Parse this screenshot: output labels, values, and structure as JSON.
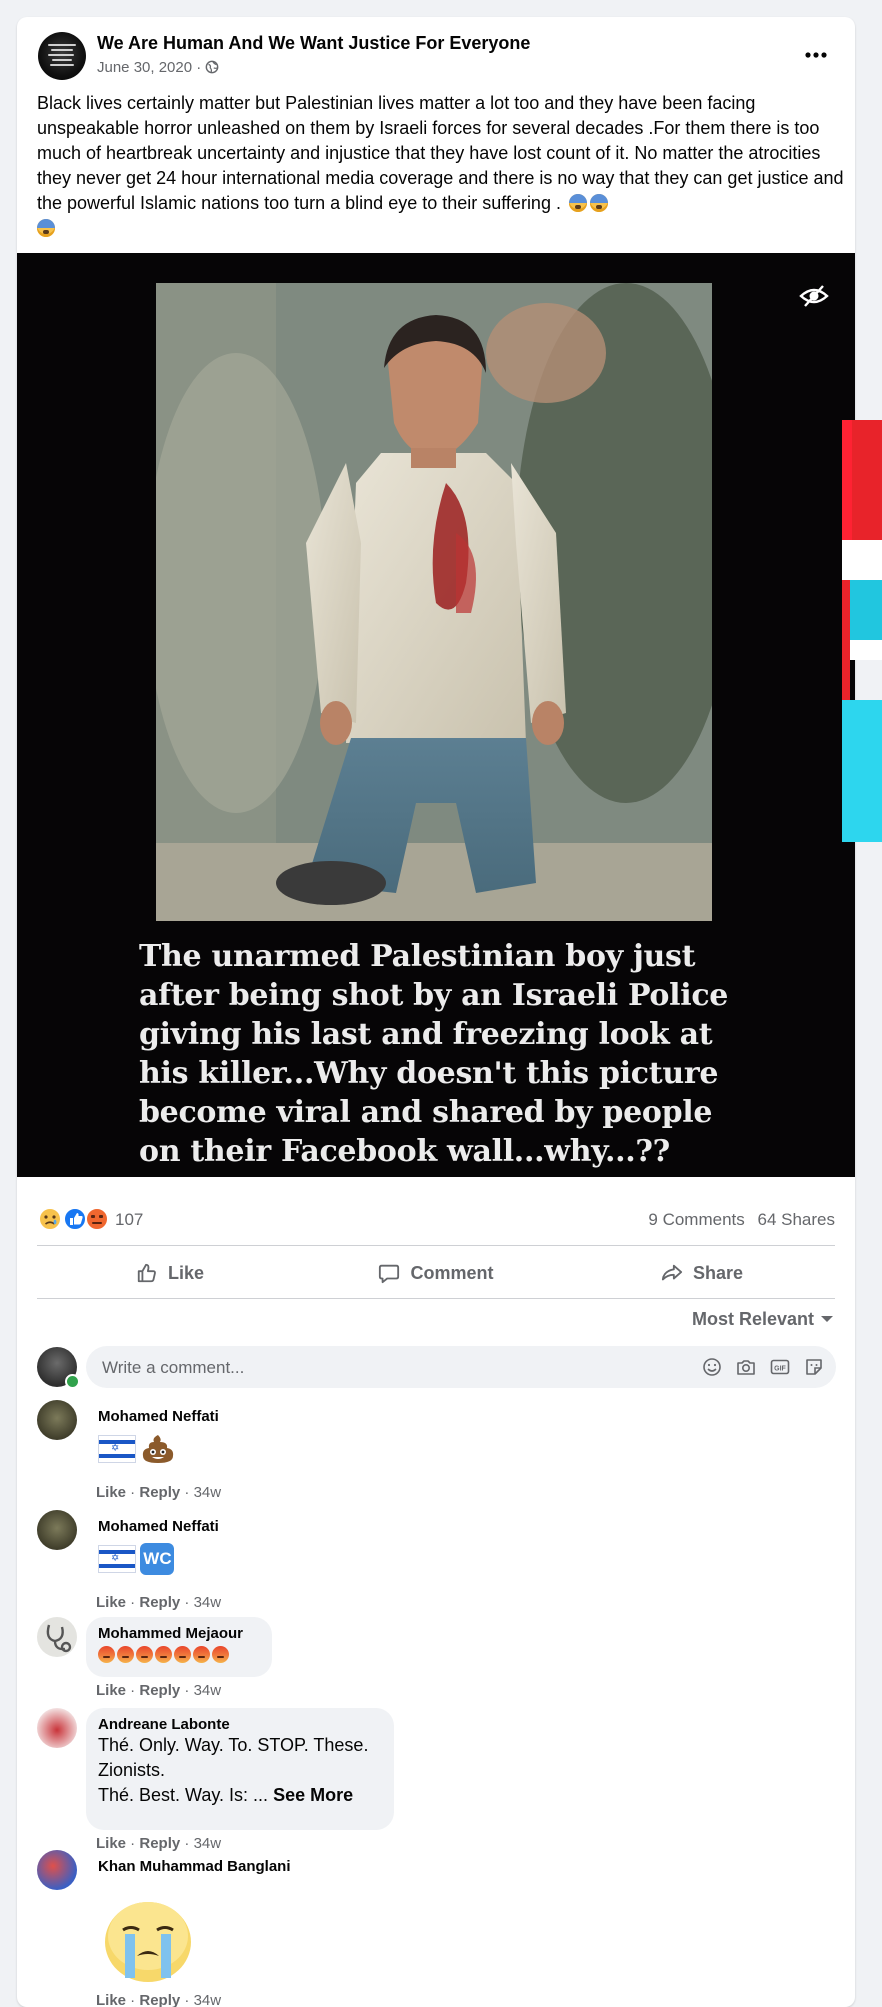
{
  "post": {
    "page_name": "We Are Human And We Want Justice For Everyone",
    "date": "June 30, 2020 ·",
    "text": "Black lives certainly matter but Palestinian lives matter a lot too and they have been facing unspeakable horror unleashed on them by Israeli forces for several decades .For them there is too much of heartbreak uncertainty and injustice that they have lost count of it. No matter the atrocities they never get 24 hour international media coverage and there is no way that they can get justice and the powerful Islamic nations too turn a blind eye to their suffering .",
    "text_emojis": [
      "fearful-face",
      "fearful-face",
      "fearful-face"
    ]
  },
  "image": {
    "caption": "The unarmed Palestinian boy just after being shot by an Israeli Police giving his last and freezing look at his killer...Why doesn't this picture become viral and shared by people on their Facebook wall...why...??"
  },
  "engagement": {
    "reaction_icons": [
      "sad",
      "like",
      "angry"
    ],
    "reaction_count": "107",
    "comments": "9 Comments",
    "shares": "64 Shares"
  },
  "actions": {
    "like": "Like",
    "comment": "Comment",
    "share": "Share"
  },
  "sort": {
    "label": "Most Relevant"
  },
  "comment_input": {
    "placeholder": "Write a comment..."
  },
  "comments": [
    {
      "name": "Mohamed Neffati",
      "emojis": [
        "israel-flag",
        "pile-of-poo"
      ],
      "like": "Like",
      "reply": "Reply",
      "time": "34w"
    },
    {
      "name": "Mohamed Neffati",
      "emojis": [
        "israel-flag",
        "wc-sign"
      ],
      "like": "Like",
      "reply": "Reply",
      "time": "34w",
      "wc_text": "WC"
    },
    {
      "name": "Mohammed Mejaour",
      "emojis": [
        "angry",
        "angry",
        "angry",
        "angry",
        "angry",
        "angry",
        "angry"
      ],
      "like": "Like",
      "reply": "Reply",
      "time": "34w"
    },
    {
      "name": "Andreane Labonte",
      "line1": "Thé. Only. Way. To. STOP. These.",
      "line2": "Zionists.",
      "line3": "Thé. Best. Way. Is: ...",
      "see_more": "See More",
      "like": "Like",
      "reply": "Reply",
      "time": "34w"
    },
    {
      "name": "Khan Muhammad Banglani",
      "sticker": "crying-face-sticker",
      "like": "Like",
      "reply": "Reply",
      "time": "34w"
    }
  ],
  "colors": {
    "background": "#f0f2f5",
    "card": "#ffffff",
    "secondary_text": "#65676b",
    "image_background": "#060506",
    "facebook_blue": "#1877f2"
  }
}
